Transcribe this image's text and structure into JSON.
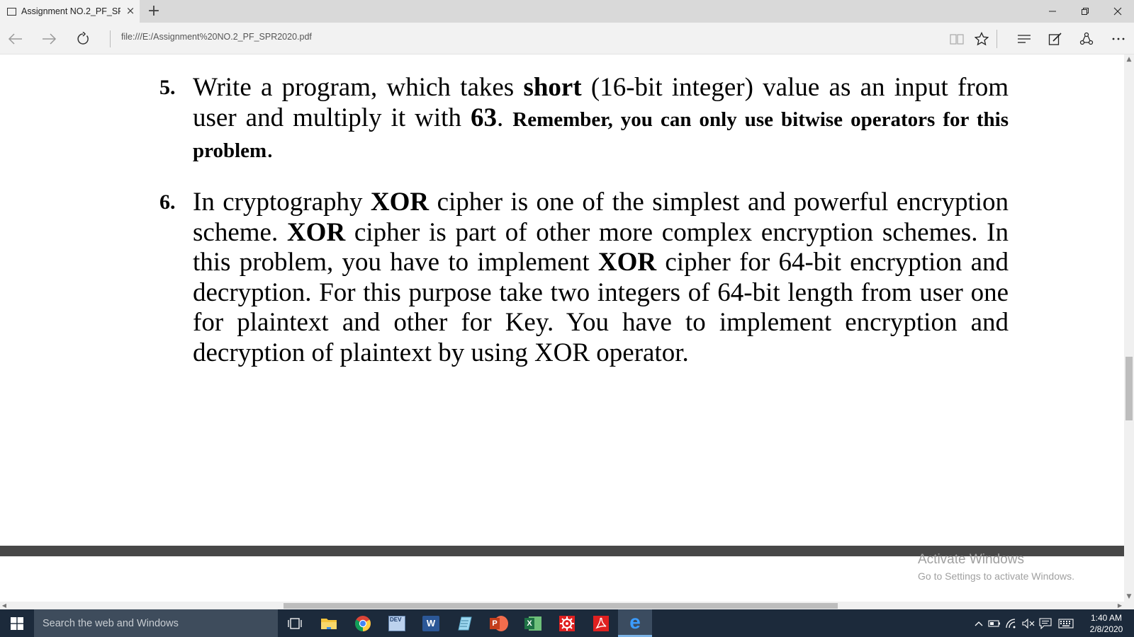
{
  "browser": {
    "tab_title": "Assignment NO.2_PF_SF",
    "new_tab_symbol": "+",
    "close_tab_symbol": "×",
    "address": "file:///E:/Assignment%20NO.2_PF_SPR2020.pdf",
    "icons": [
      "tab-page-icon",
      "back-icon",
      "forward-icon",
      "refresh-icon",
      "reading-view-icon",
      "favorite-star-icon",
      "hub-icon",
      "web-note-icon",
      "share-icon",
      "more-icon",
      "minimize-icon",
      "restore-icon",
      "close-window-icon"
    ]
  },
  "document": {
    "q5": {
      "number": "5.",
      "t1": "Write a program, which takes ",
      "b1": "short",
      "t2": " (16-bit integer) value as an input from user and multiply it with ",
      "b2": "63",
      "t3": ". ",
      "b3": "Remember, you can only use bitwise operators for this problem",
      "t4": "."
    },
    "q6": {
      "number": "6.",
      "t1": "In cryptography ",
      "b1": "XOR",
      "t2": " cipher is one of the simplest and powerful encryption scheme. ",
      "b2": "XOR",
      "t3": " cipher is part of other more complex encryption schemes. In this problem, you have to implement ",
      "b3": "XOR",
      "t4": " cipher for 64-bit encryption and decryption. For this purpose take two integers of 64-bit length from user one for plaintext and other for Key. You have to implement encryption and decryption of plaintext by using XOR operator."
    }
  },
  "watermark": {
    "title": "Activate Windows",
    "subtitle": "Go to Settings to activate Windows."
  },
  "taskbar": {
    "search_placeholder": "Search the web and Windows",
    "apps": [
      "task-view-icon",
      "file-explorer-icon",
      "chrome-icon",
      "dev-cpp-icon",
      "word-icon",
      "notepad-icon",
      "powerpoint-icon",
      "excel-icon",
      "settings-app-icon",
      "acrobat-icon",
      "edge-icon"
    ],
    "dev_label": "DEV",
    "word_label": "W",
    "excel_label": "X",
    "ppt_label": "P",
    "edge_label": "e",
    "time": "1:40 AM",
    "date": "2/8/2020"
  },
  "colors": {
    "taskbar": "#1c2a3b",
    "search_box": "#3e4c5c",
    "page_gap": "#474747",
    "edge_blue": "#0078d7"
  }
}
